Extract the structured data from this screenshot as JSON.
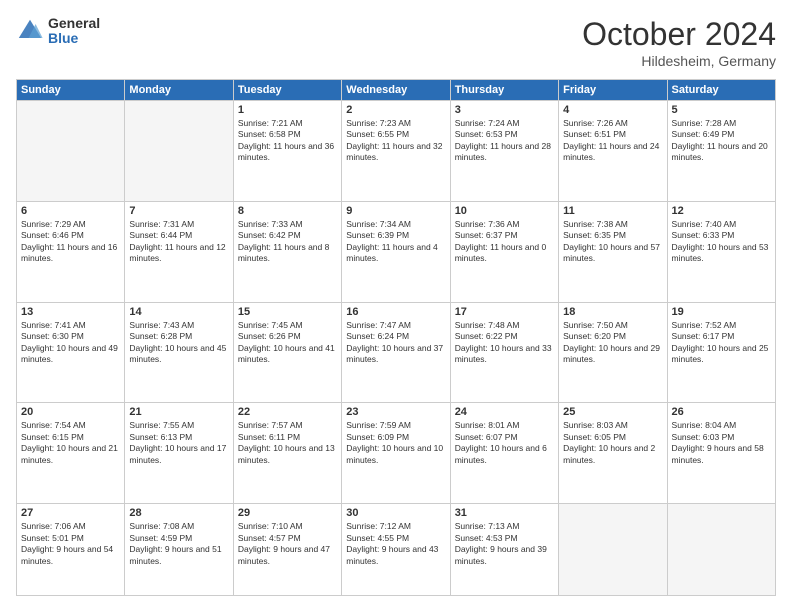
{
  "header": {
    "logo_general": "General",
    "logo_blue": "Blue",
    "month": "October 2024",
    "location": "Hildesheim, Germany"
  },
  "weekdays": [
    "Sunday",
    "Monday",
    "Tuesday",
    "Wednesday",
    "Thursday",
    "Friday",
    "Saturday"
  ],
  "weeks": [
    [
      {
        "day": "",
        "info": ""
      },
      {
        "day": "",
        "info": ""
      },
      {
        "day": "1",
        "info": "Sunrise: 7:21 AM\nSunset: 6:58 PM\nDaylight: 11 hours and 36 minutes."
      },
      {
        "day": "2",
        "info": "Sunrise: 7:23 AM\nSunset: 6:55 PM\nDaylight: 11 hours and 32 minutes."
      },
      {
        "day": "3",
        "info": "Sunrise: 7:24 AM\nSunset: 6:53 PM\nDaylight: 11 hours and 28 minutes."
      },
      {
        "day": "4",
        "info": "Sunrise: 7:26 AM\nSunset: 6:51 PM\nDaylight: 11 hours and 24 minutes."
      },
      {
        "day": "5",
        "info": "Sunrise: 7:28 AM\nSunset: 6:49 PM\nDaylight: 11 hours and 20 minutes."
      }
    ],
    [
      {
        "day": "6",
        "info": "Sunrise: 7:29 AM\nSunset: 6:46 PM\nDaylight: 11 hours and 16 minutes."
      },
      {
        "day": "7",
        "info": "Sunrise: 7:31 AM\nSunset: 6:44 PM\nDaylight: 11 hours and 12 minutes."
      },
      {
        "day": "8",
        "info": "Sunrise: 7:33 AM\nSunset: 6:42 PM\nDaylight: 11 hours and 8 minutes."
      },
      {
        "day": "9",
        "info": "Sunrise: 7:34 AM\nSunset: 6:39 PM\nDaylight: 11 hours and 4 minutes."
      },
      {
        "day": "10",
        "info": "Sunrise: 7:36 AM\nSunset: 6:37 PM\nDaylight: 11 hours and 0 minutes."
      },
      {
        "day": "11",
        "info": "Sunrise: 7:38 AM\nSunset: 6:35 PM\nDaylight: 10 hours and 57 minutes."
      },
      {
        "day": "12",
        "info": "Sunrise: 7:40 AM\nSunset: 6:33 PM\nDaylight: 10 hours and 53 minutes."
      }
    ],
    [
      {
        "day": "13",
        "info": "Sunrise: 7:41 AM\nSunset: 6:30 PM\nDaylight: 10 hours and 49 minutes."
      },
      {
        "day": "14",
        "info": "Sunrise: 7:43 AM\nSunset: 6:28 PM\nDaylight: 10 hours and 45 minutes."
      },
      {
        "day": "15",
        "info": "Sunrise: 7:45 AM\nSunset: 6:26 PM\nDaylight: 10 hours and 41 minutes."
      },
      {
        "day": "16",
        "info": "Sunrise: 7:47 AM\nSunset: 6:24 PM\nDaylight: 10 hours and 37 minutes."
      },
      {
        "day": "17",
        "info": "Sunrise: 7:48 AM\nSunset: 6:22 PM\nDaylight: 10 hours and 33 minutes."
      },
      {
        "day": "18",
        "info": "Sunrise: 7:50 AM\nSunset: 6:20 PM\nDaylight: 10 hours and 29 minutes."
      },
      {
        "day": "19",
        "info": "Sunrise: 7:52 AM\nSunset: 6:17 PM\nDaylight: 10 hours and 25 minutes."
      }
    ],
    [
      {
        "day": "20",
        "info": "Sunrise: 7:54 AM\nSunset: 6:15 PM\nDaylight: 10 hours and 21 minutes."
      },
      {
        "day": "21",
        "info": "Sunrise: 7:55 AM\nSunset: 6:13 PM\nDaylight: 10 hours and 17 minutes."
      },
      {
        "day": "22",
        "info": "Sunrise: 7:57 AM\nSunset: 6:11 PM\nDaylight: 10 hours and 13 minutes."
      },
      {
        "day": "23",
        "info": "Sunrise: 7:59 AM\nSunset: 6:09 PM\nDaylight: 10 hours and 10 minutes."
      },
      {
        "day": "24",
        "info": "Sunrise: 8:01 AM\nSunset: 6:07 PM\nDaylight: 10 hours and 6 minutes."
      },
      {
        "day": "25",
        "info": "Sunrise: 8:03 AM\nSunset: 6:05 PM\nDaylight: 10 hours and 2 minutes."
      },
      {
        "day": "26",
        "info": "Sunrise: 8:04 AM\nSunset: 6:03 PM\nDaylight: 9 hours and 58 minutes."
      }
    ],
    [
      {
        "day": "27",
        "info": "Sunrise: 7:06 AM\nSunset: 5:01 PM\nDaylight: 9 hours and 54 minutes."
      },
      {
        "day": "28",
        "info": "Sunrise: 7:08 AM\nSunset: 4:59 PM\nDaylight: 9 hours and 51 minutes."
      },
      {
        "day": "29",
        "info": "Sunrise: 7:10 AM\nSunset: 4:57 PM\nDaylight: 9 hours and 47 minutes."
      },
      {
        "day": "30",
        "info": "Sunrise: 7:12 AM\nSunset: 4:55 PM\nDaylight: 9 hours and 43 minutes."
      },
      {
        "day": "31",
        "info": "Sunrise: 7:13 AM\nSunset: 4:53 PM\nDaylight: 9 hours and 39 minutes."
      },
      {
        "day": "",
        "info": ""
      },
      {
        "day": "",
        "info": ""
      }
    ]
  ]
}
